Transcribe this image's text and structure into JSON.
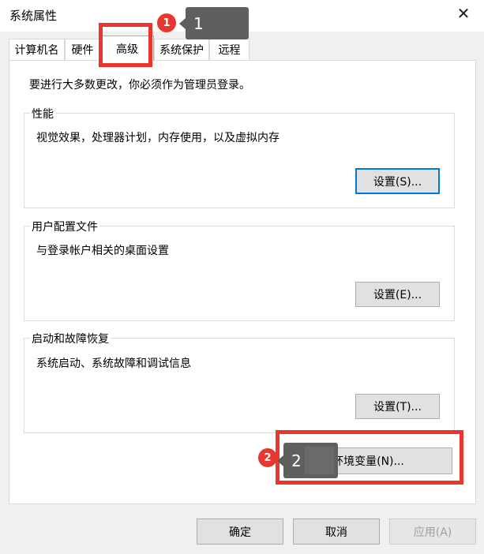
{
  "window": {
    "title": "系统属性",
    "close_glyph": "✕"
  },
  "tabs": [
    {
      "label": "计算机名"
    },
    {
      "label": "硬件"
    },
    {
      "label": "高级"
    },
    {
      "label": "系统保护"
    },
    {
      "label": "远程"
    }
  ],
  "active_tab": "高级",
  "intro": "要进行大多数更改，你必须作为管理员登录。",
  "performance": {
    "label": "性能",
    "desc": "视觉效果，处理器计划，内存使用，以及虚拟内存",
    "button": "设置(S)..."
  },
  "user_profiles": {
    "label": "用户配置文件",
    "desc": "与登录帐户相关的桌面设置",
    "button": "设置(E)..."
  },
  "startup_recovery": {
    "label": "启动和故障恢复",
    "desc": "系统启动、系统故障和调试信息",
    "button": "设置(T)..."
  },
  "env_button": "环境变量(N)...",
  "footer": {
    "ok": "确定",
    "cancel": "取消",
    "apply": "应用(A)"
  },
  "annotations": {
    "badge1": "1",
    "tip1": "1",
    "badge2": "2",
    "tip2": "2",
    "color": "#e8372e"
  }
}
